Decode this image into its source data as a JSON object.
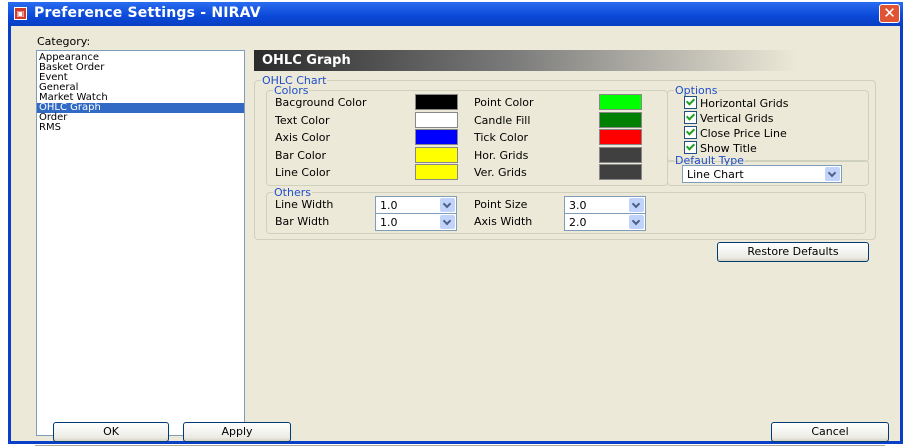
{
  "window": {
    "title": "Preference Settings - NIRAV"
  },
  "category": {
    "label": "Category:",
    "items": [
      "Appearance",
      "Basket Order",
      "Event",
      "General",
      "Market Watch",
      "OHLC Graph",
      "Order",
      "RMS"
    ],
    "selected": "OHLC Graph"
  },
  "panel": {
    "title": "OHLC Graph",
    "ohlc_chart_legend": "OHLC Chart",
    "colors": {
      "legend": "Colors",
      "left": [
        {
          "label": "Bacground Color",
          "color": "#000000"
        },
        {
          "label": "Text Color",
          "color": "#ffffff"
        },
        {
          "label": "Axis Color",
          "color": "#0000ff"
        },
        {
          "label": "Bar Color",
          "color": "#ffff00"
        },
        {
          "label": "Line Color",
          "color": "#ffff00"
        }
      ],
      "right": [
        {
          "label": "Point Color",
          "color": "#00ff00"
        },
        {
          "label": "Candle Fill",
          "color": "#008000"
        },
        {
          "label": "Tick Color",
          "color": "#ff0000"
        },
        {
          "label": "Hor. Grids",
          "color": "#404040"
        },
        {
          "label": "Ver. Grids",
          "color": "#404040"
        }
      ]
    },
    "others": {
      "legend": "Others",
      "line_width": {
        "label": "Line Width",
        "value": "1.0"
      },
      "bar_width": {
        "label": "Bar Width",
        "value": "1.0"
      },
      "point_size": {
        "label": "Point Size",
        "value": "3.0"
      },
      "axis_width": {
        "label": "Axis Width",
        "value": "2.0"
      }
    },
    "options": {
      "legend": "Options",
      "items": [
        "Horizontal Grids",
        "Vertical Grids",
        "Close Price Line",
        "Show Title"
      ]
    },
    "default_type": {
      "legend": "Default Type",
      "value": "Line Chart"
    },
    "restore_defaults": "Restore Defaults"
  },
  "buttons": {
    "ok": "OK",
    "apply": "Apply",
    "cancel": "Cancel"
  }
}
